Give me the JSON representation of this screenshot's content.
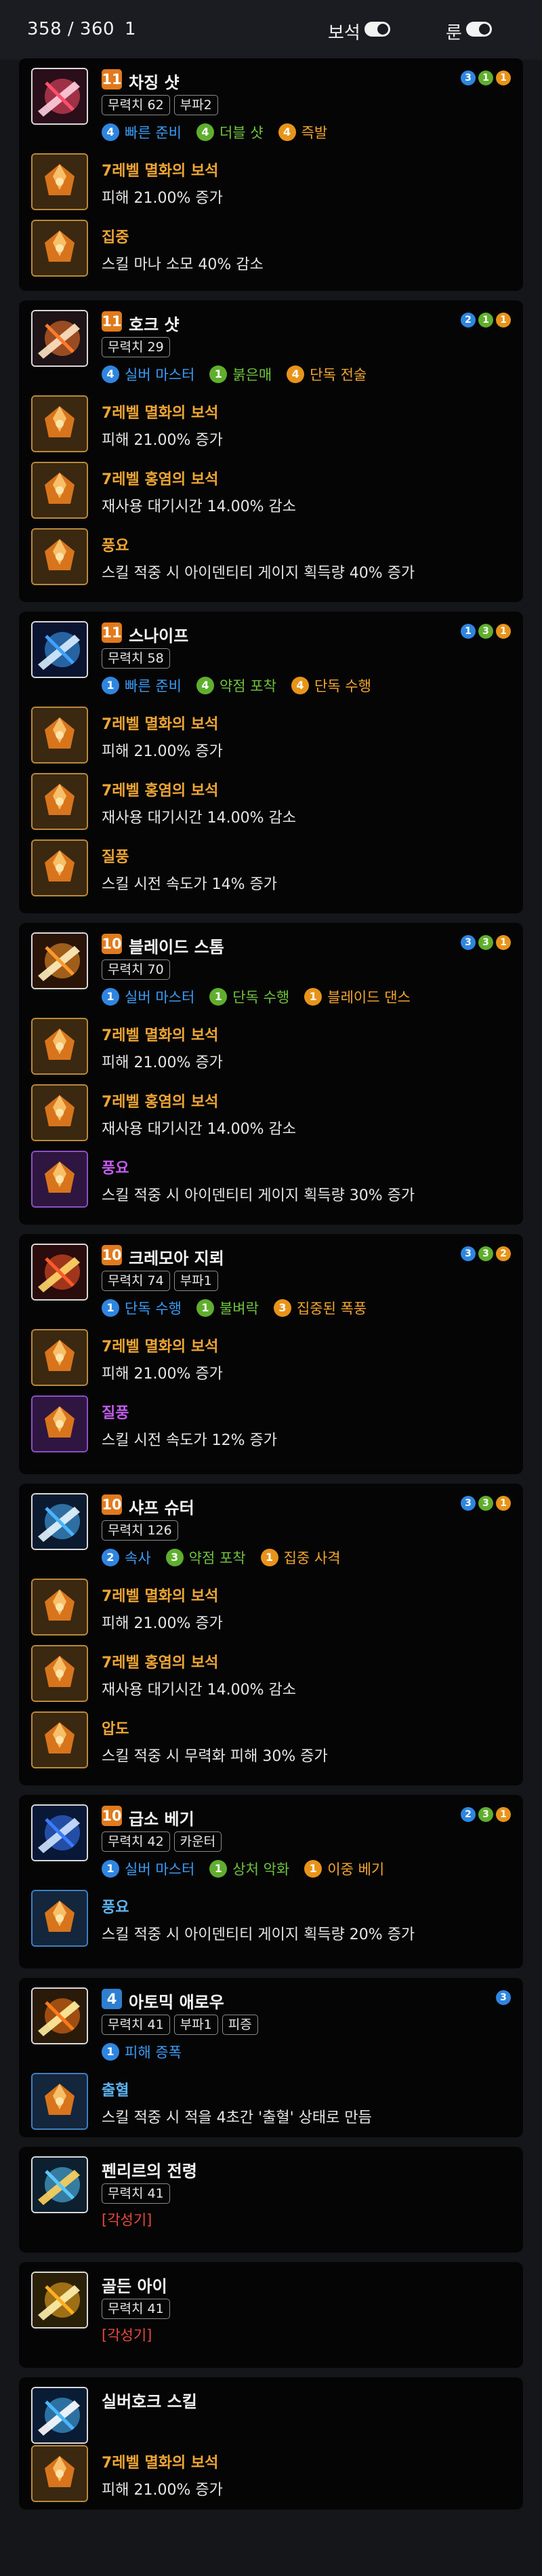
{
  "header": {
    "points": "358 / 360",
    "number": "1",
    "gem_toggle_label": "보석",
    "rune_toggle_label": "룬"
  },
  "skills": [
    {
      "level": "11",
      "name": "차징 샷",
      "tags": [
        "무력치 62",
        "부파2"
      ],
      "tripods": [
        {
          "num": "4",
          "label": "빠른 준비",
          "color": "blue"
        },
        {
          "num": "4",
          "label": "더블 샷",
          "color": "green"
        },
        {
          "num": "4",
          "label": "즉발",
          "color": "orange"
        }
      ],
      "dots": [
        "3",
        "1",
        "1"
      ],
      "rows": [
        {
          "title": "7레벨 멸화의 보석",
          "desc": "피해 21.00% 증가",
          "style": "gold"
        },
        {
          "title": "집중",
          "desc": "스킬 마나 소모 40% 감소",
          "style": "gold"
        }
      ]
    },
    {
      "level": "11",
      "name": "호크 샷",
      "tags": [
        "무력치 29"
      ],
      "tripods": [
        {
          "num": "4",
          "label": "실버 마스터",
          "color": "blue"
        },
        {
          "num": "1",
          "label": "붉은매",
          "color": "green"
        },
        {
          "num": "4",
          "label": "단독 전술",
          "color": "orange"
        }
      ],
      "dots": [
        "2",
        "1",
        "1"
      ],
      "rows": [
        {
          "title": "7레벨 멸화의 보석",
          "desc": "피해 21.00% 증가",
          "style": "gold"
        },
        {
          "title": "7레벨 홍염의 보석",
          "desc": "재사용 대기시간 14.00% 감소",
          "style": "gold"
        },
        {
          "title": "풍요",
          "desc": "스킬 적중 시 아이덴티티 게이지 획득량 40% 증가",
          "style": "gold"
        }
      ]
    },
    {
      "level": "11",
      "name": "스나이프",
      "tags": [
        "무력치 58"
      ],
      "tripods": [
        {
          "num": "1",
          "label": "빠른 준비",
          "color": "blue"
        },
        {
          "num": "4",
          "label": "약점 포착",
          "color": "green"
        },
        {
          "num": "4",
          "label": "단독 수행",
          "color": "orange"
        }
      ],
      "dots": [
        "1",
        "3",
        "1"
      ],
      "rows": [
        {
          "title": "7레벨 멸화의 보석",
          "desc": "피해 21.00% 증가",
          "style": "gold"
        },
        {
          "title": "7레벨 홍염의 보석",
          "desc": "재사용 대기시간 14.00% 감소",
          "style": "gold"
        },
        {
          "title": "질풍",
          "desc": "스킬 시전 속도가 14% 증가",
          "style": "gold"
        }
      ]
    },
    {
      "level": "10",
      "name": "블레이드 스톰",
      "tags": [
        "무력치 70"
      ],
      "tripods": [
        {
          "num": "1",
          "label": "실버 마스터",
          "color": "blue"
        },
        {
          "num": "1",
          "label": "단독 수행",
          "color": "green"
        },
        {
          "num": "1",
          "label": "블레이드 댄스",
          "color": "orange"
        }
      ],
      "dots": [
        "3",
        "3",
        "1"
      ],
      "rows": [
        {
          "title": "7레벨 멸화의 보석",
          "desc": "피해 21.00% 증가",
          "style": "gold"
        },
        {
          "title": "7레벨 홍염의 보석",
          "desc": "재사용 대기시간 14.00% 감소",
          "style": "gold"
        },
        {
          "title": "풍요",
          "desc": "스킬 적중 시 아이덴티티 게이지 획득량 30% 증가",
          "style": "purple"
        }
      ]
    },
    {
      "level": "10",
      "name": "크레모아 지뢰",
      "tags": [
        "무력치 74",
        "부파1"
      ],
      "tripods": [
        {
          "num": "1",
          "label": "단독 수행",
          "color": "blue"
        },
        {
          "num": "1",
          "label": "불벼락",
          "color": "green"
        },
        {
          "num": "3",
          "label": "집중된 폭풍",
          "color": "orange"
        }
      ],
      "dots": [
        "3",
        "3",
        "2"
      ],
      "rows": [
        {
          "title": "7레벨 멸화의 보석",
          "desc": "피해 21.00% 증가",
          "style": "gold"
        },
        {
          "title": "질풍",
          "desc": "스킬 시전 속도가 12% 증가",
          "style": "purple"
        }
      ]
    },
    {
      "level": "10",
      "name": "샤프 슈터",
      "tags": [
        "무력치 126"
      ],
      "tripods": [
        {
          "num": "2",
          "label": "속사",
          "color": "blue"
        },
        {
          "num": "3",
          "label": "약점 포착",
          "color": "green"
        },
        {
          "num": "1",
          "label": "집중 사격",
          "color": "orange"
        }
      ],
      "dots": [
        "3",
        "3",
        "1"
      ],
      "rows": [
        {
          "title": "7레벨 멸화의 보석",
          "desc": "피해 21.00% 증가",
          "style": "gold"
        },
        {
          "title": "7레벨 홍염의 보석",
          "desc": "재사용 대기시간 14.00% 감소",
          "style": "gold"
        },
        {
          "title": "압도",
          "desc": "스킬 적중 시 무력화 피해 30% 증가",
          "style": "gold"
        }
      ]
    },
    {
      "level": "10",
      "name": "급소 베기",
      "tags": [
        "무력치 42",
        "카운터"
      ],
      "tripods": [
        {
          "num": "1",
          "label": "실버 마스터",
          "color": "blue"
        },
        {
          "num": "1",
          "label": "상처 악화",
          "color": "green"
        },
        {
          "num": "1",
          "label": "이중 베기",
          "color": "orange"
        }
      ],
      "dots": [
        "2",
        "3",
        "1"
      ],
      "rows": [
        {
          "title": "풍요",
          "desc": "스킬 적중 시 아이덴티티 게이지 획득량 20% 증가",
          "style": "blue"
        }
      ]
    },
    {
      "level": "4",
      "name": "아토믹 애로우",
      "tags": [
        "무력치 41",
        "부파1",
        "피증"
      ],
      "tripods": [
        {
          "num": "1",
          "label": "피해 증폭",
          "color": "blue"
        }
      ],
      "dots": [
        "3"
      ],
      "rows": [
        {
          "title": "출혈",
          "desc": "스킬 적중 시 적을 4초간 '출혈' 상태로 만듬",
          "style": "blue"
        }
      ]
    },
    {
      "level": "",
      "name": "펜리르의 전령",
      "tags": [
        "무력치 41"
      ],
      "awakening": "[각성기]",
      "tripods": [],
      "dots": [],
      "rows": []
    },
    {
      "level": "",
      "name": "골든 아이",
      "tags": [
        "무력치 41"
      ],
      "awakening": "[각성기]",
      "tripods": [],
      "dots": [],
      "rows": []
    },
    {
      "level": "",
      "name": "실버호크 스킬",
      "tags": [],
      "tripods": [],
      "dots": [],
      "rows": [
        {
          "title": "7레벨 멸화의 보석",
          "desc": "피해 21.00% 증가",
          "style": "gold"
        }
      ]
    }
  ]
}
